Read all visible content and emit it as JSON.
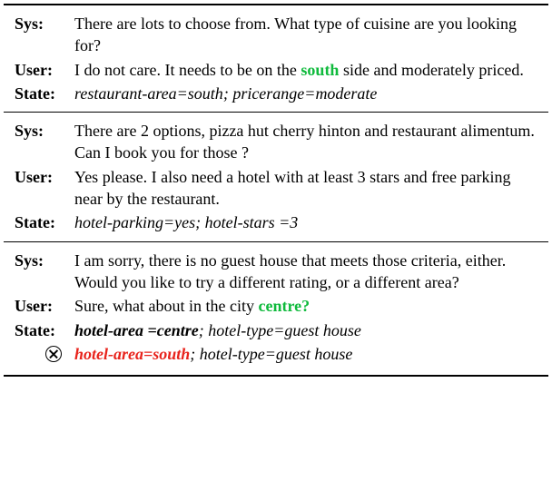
{
  "labels": {
    "sys": "Sys:",
    "user": "User:",
    "state": "State:"
  },
  "sections": [
    {
      "sys": "There are lots to choose from. What type of cuisine are you looking for?",
      "user_pre": "I do not care. It needs to be on the ",
      "user_highlight": "south",
      "user_post": " side and moderately priced.",
      "state": "restaurant-area=south",
      "state_sep": "; ",
      "state2": "pricerange=moderate",
      "has_error": false
    },
    {
      "sys": "There are 2 options, pizza hut cherry hinton and restaurant alimentum. Can I book you for those ?",
      "user_pre": "Yes please. I also need a hotel with at least 3 stars and free parking near by the restaurant.",
      "user_highlight": "",
      "user_post": "",
      "state": "hotel-parking=yes",
      "state_sep": "; ",
      "state2": "hotel-stars =3",
      "has_error": false
    },
    {
      "sys": "I am sorry, there is no guest house that meets those criteria, either.  Would you like to try a different rating, or a different area?",
      "user_pre": "Sure, what about in the city ",
      "user_highlight": "centre?",
      "user_post": "",
      "state": "hotel-area =centre",
      "state_sep": "; ",
      "state2": "hotel-type=guest house",
      "has_error": true,
      "error_state": "hotel-area=south",
      "error_sep": "; ",
      "error_state2": "hotel-type=guest house"
    }
  ]
}
